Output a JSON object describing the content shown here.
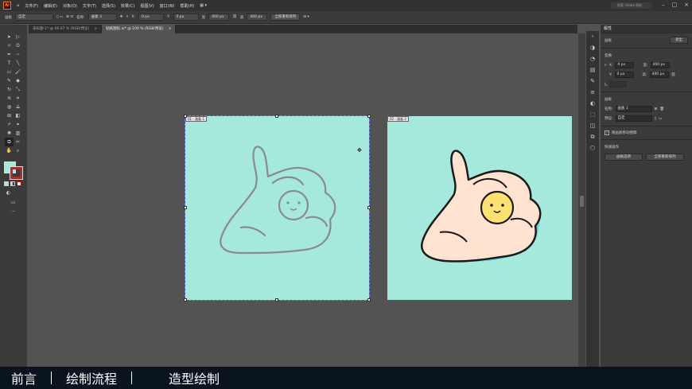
{
  "menubar": {
    "logo": "Ai",
    "items": [
      "文件(F)",
      "编辑(E)",
      "对象(O)",
      "文字(T)",
      "选择(S)",
      "效果(C)",
      "视图(V)",
      "窗口(W)",
      "帮助(H)"
    ],
    "search_placeholder": "搜索 Adobe 帮助"
  },
  "control": {
    "label_left": "画板",
    "preset": "自定",
    "name_label": "名称:",
    "name_value": "画板 3",
    "x_value": "0 px",
    "y_value": "0 px",
    "w_label": "宽",
    "w_value": "400 px",
    "h_label": "高",
    "h_value": "400 px",
    "rearrange_label": "全部重新排列"
  },
  "tabs": [
    {
      "label": "未标题-1* @ 66.67 % (RGB/预览)",
      "close": "×"
    },
    {
      "label": "贴纸图标.ai* @ 100 % (RGB/预览)",
      "close": "×"
    }
  ],
  "artboards": [
    {
      "label": "01 - 画板 1"
    },
    {
      "label": "02 - 画板 2"
    }
  ],
  "colors": {
    "artboard_bg": "#a5e9dc",
    "sketch": "#8a8a8a",
    "skin": "#ffe2cf",
    "outline": "#1a1a1a",
    "face": "#ffe170",
    "shadow": "#66d1dc",
    "accent_orange": "#ff9a00"
  },
  "props": {
    "tab": "属性",
    "section_artboard": "画板",
    "exit_label": "退出",
    "transform_label": "变换",
    "x_label": "X:",
    "x_value": "0 px",
    "y_label": "Y:",
    "y_value": "0 px",
    "w_label": "宽:",
    "w_value": "400 px",
    "h_label": "高:",
    "h_value": "400 px",
    "artboard_section": "画板",
    "name_label": "名称:",
    "name_value": "画板 1",
    "preset_label": "预设:",
    "preset_value": "自定",
    "move_checkbox_label": "随画板移动图稿",
    "quick_actions": "快速操作",
    "artboard_options": "画板选项",
    "rearrange_all": "全部重新排列"
  },
  "caption": {
    "item1": "前言",
    "item2": "绘制流程",
    "item3": "造型绘制"
  }
}
